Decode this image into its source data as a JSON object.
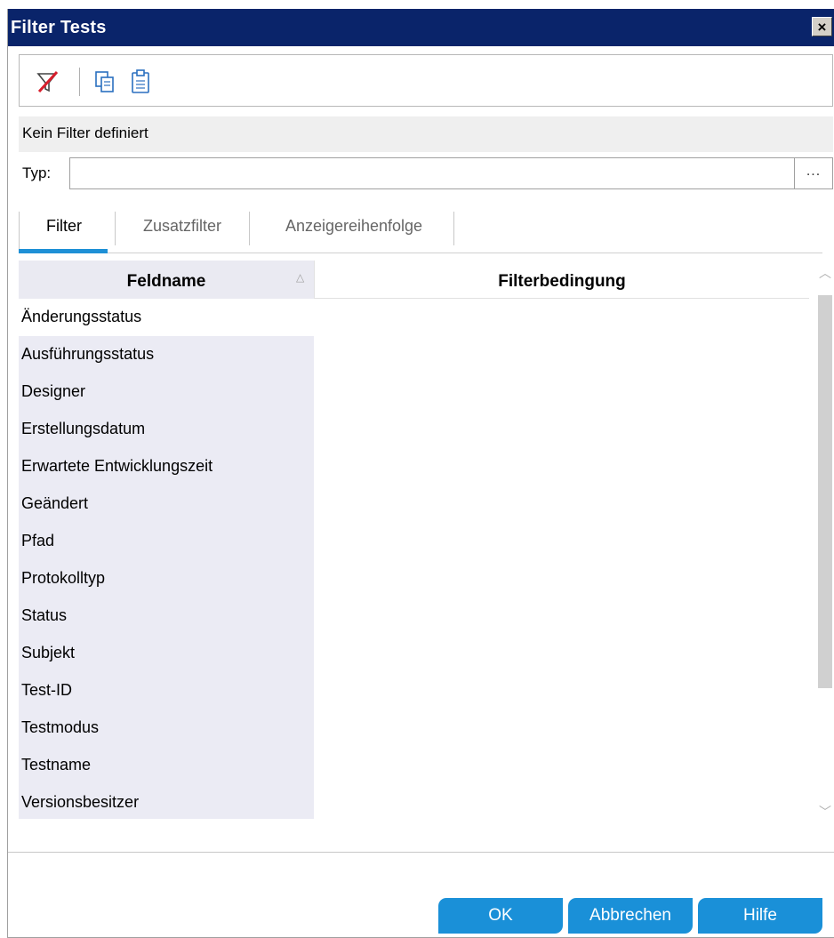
{
  "window": {
    "title": "Filter Tests",
    "close_label": "×"
  },
  "toolbar": {
    "clear_filter_icon": "clear-filter-icon",
    "copy_icon": "copy-icon",
    "paste_icon": "paste-icon"
  },
  "status": {
    "text": "Kein Filter definiert"
  },
  "typ": {
    "label": "Typ:",
    "value": "",
    "browse_label": "..."
  },
  "tabs": [
    {
      "label": "Filter",
      "active": true
    },
    {
      "label": "Zusatzfilter",
      "active": false
    },
    {
      "label": "Anzeigereihenfolge",
      "active": false
    }
  ],
  "grid": {
    "headers": {
      "field": "Feldname",
      "condition": "Filterbedingung"
    },
    "rows": [
      {
        "field": "Änderungsstatus",
        "condition": ""
      },
      {
        "field": "Ausführungsstatus",
        "condition": ""
      },
      {
        "field": "Designer",
        "condition": ""
      },
      {
        "field": "Erstellungsdatum",
        "condition": ""
      },
      {
        "field": "Erwartete Entwicklungszeit",
        "condition": ""
      },
      {
        "field": "Geändert",
        "condition": ""
      },
      {
        "field": "Pfad",
        "condition": ""
      },
      {
        "field": "Protokolltyp",
        "condition": ""
      },
      {
        "field": "Status",
        "condition": ""
      },
      {
        "field": "Subjekt",
        "condition": ""
      },
      {
        "field": "Test-ID",
        "condition": ""
      },
      {
        "field": "Testmodus",
        "condition": ""
      },
      {
        "field": "Testname",
        "condition": ""
      },
      {
        "field": "Versionsbesitzer",
        "condition": ""
      }
    ]
  },
  "buttons": {
    "ok": "OK",
    "cancel": "Abbrechen",
    "help": "Hilfe"
  },
  "colors": {
    "titlebar": "#0a246a",
    "accent": "#1a90d8",
    "field_column": "#ebebf4"
  }
}
